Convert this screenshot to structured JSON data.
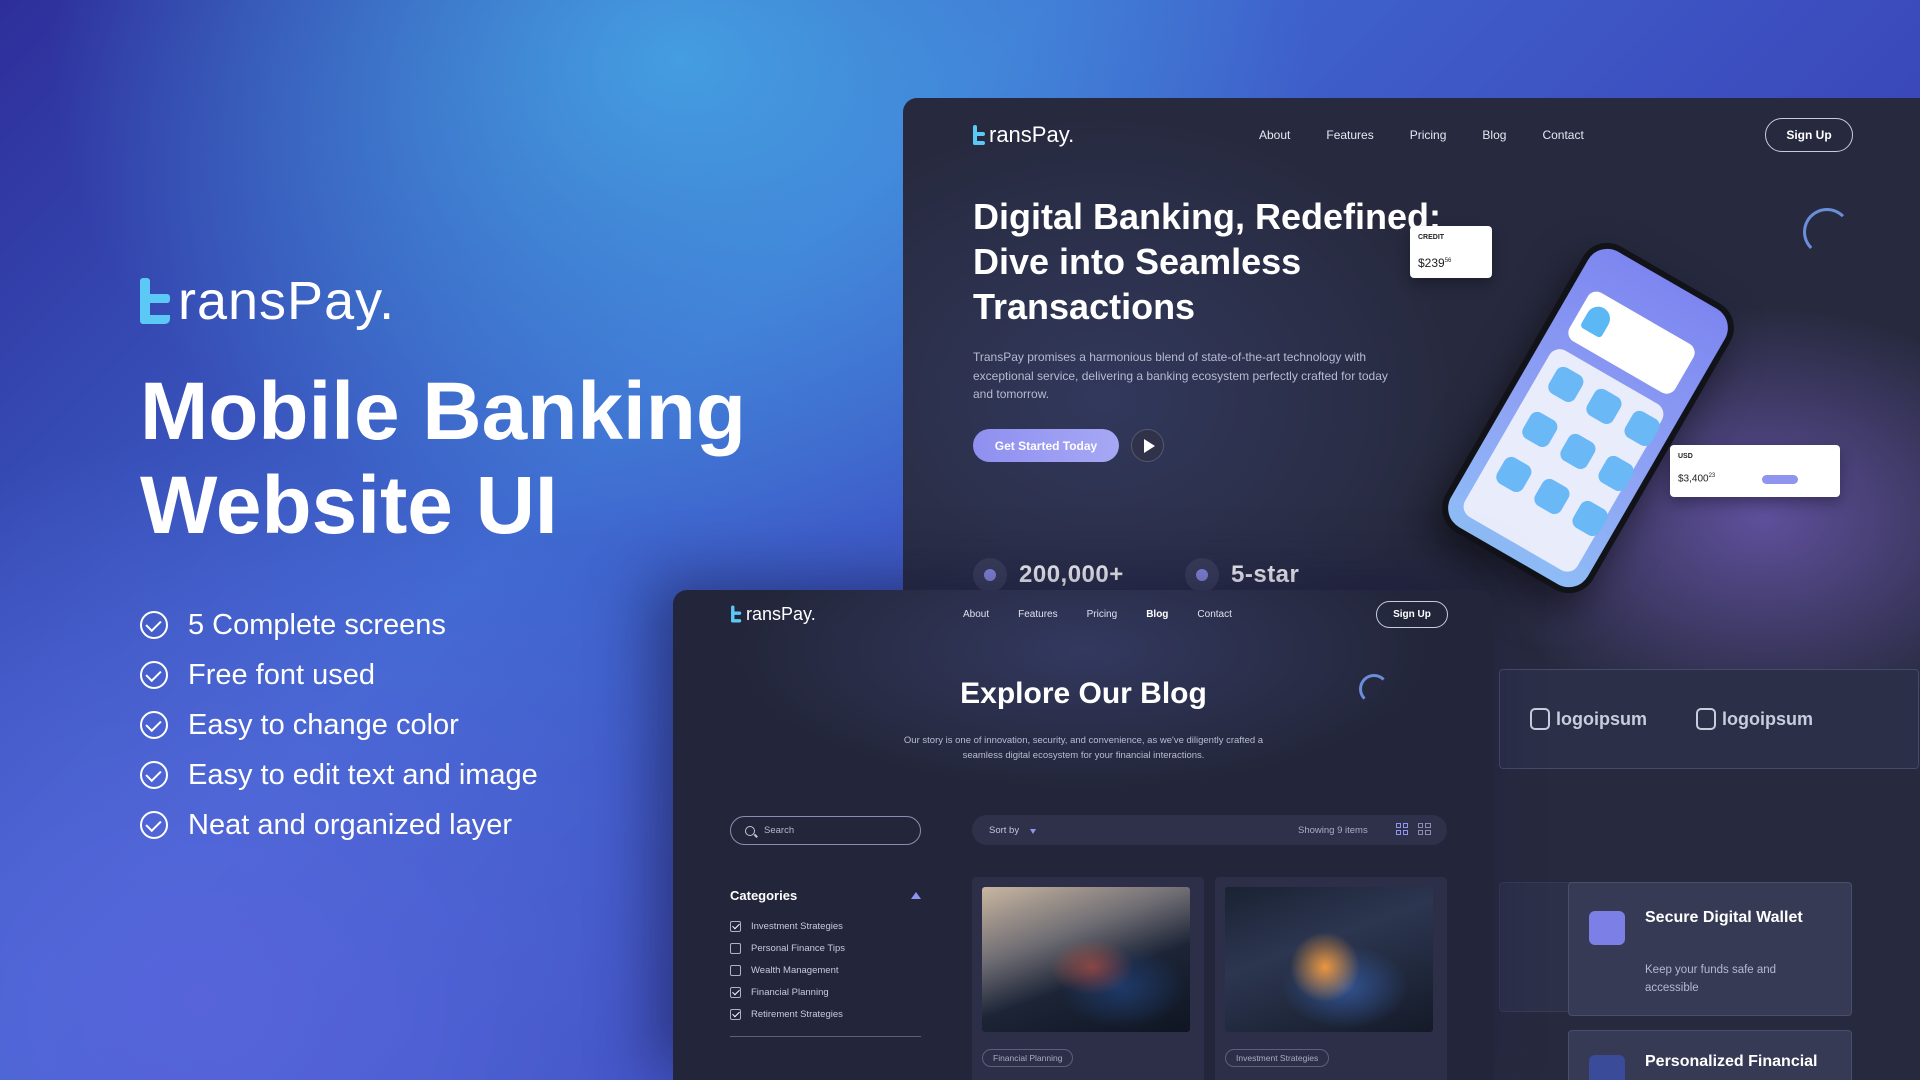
{
  "brand": {
    "name": "ransPay.",
    "accent": "#5cc8f5",
    "primary": "#8f94ef"
  },
  "hero": {
    "title": "Mobile Banking Website UI",
    "features": [
      "5 Complete screens",
      "Free font used",
      "Easy to change color",
      "Easy to edit text and image",
      "Neat and organized layer"
    ]
  },
  "landing": {
    "nav": {
      "links": [
        "About",
        "Features",
        "Pricing",
        "Blog",
        "Contact"
      ],
      "signup": "Sign Up"
    },
    "headline": "Digital Banking, Redefined: Dive into Seamless Transactions",
    "description": "TransPay promises a harmonious blend of state-of-the-art technology with exceptional service, delivering a banking ecosystem perfectly crafted for today and tomorrow.",
    "cta": "Get Started Today",
    "stats": [
      "200,000+",
      "5-star"
    ],
    "credit_card": {
      "label": "CREDIT",
      "amount": "$239",
      "cents": "56"
    },
    "usd_card": {
      "label": "USD",
      "amount": "$3,400",
      "cents": "23"
    },
    "partners": [
      "logoipsum",
      "logoipsum"
    ],
    "feature_cards": [
      {
        "title": "Secure Digital Wallet",
        "desc": "Keep your funds safe and accessible",
        "icon": "wallet-icon"
      },
      {
        "title": "Personalized Financial",
        "icon": "chart-icon"
      }
    ]
  },
  "blog": {
    "nav": {
      "links": [
        "About",
        "Features",
        "Pricing",
        "Blog",
        "Contact"
      ],
      "active": "Blog",
      "signup": "Sign Up"
    },
    "title": "Explore Our Blog",
    "subtitle": "Our story is one of innovation, security, and convenience, as we've diligently crafted a seamless digital ecosystem for your financial interactions.",
    "search_placeholder": "Search",
    "categories_label": "Categories",
    "categories": [
      {
        "label": "Investment Strategies",
        "checked": true
      },
      {
        "label": "Personal Finance Tips",
        "checked": false
      },
      {
        "label": "Wealth Management",
        "checked": false
      },
      {
        "label": "Financial Planning",
        "checked": true
      },
      {
        "label": "Retirement Strategies",
        "checked": true
      }
    ],
    "sort_label": "Sort by",
    "count_label": "Showing 9 items",
    "posts": [
      {
        "tag": "Financial Planning"
      },
      {
        "tag": "Investment Strategies"
      }
    ]
  }
}
